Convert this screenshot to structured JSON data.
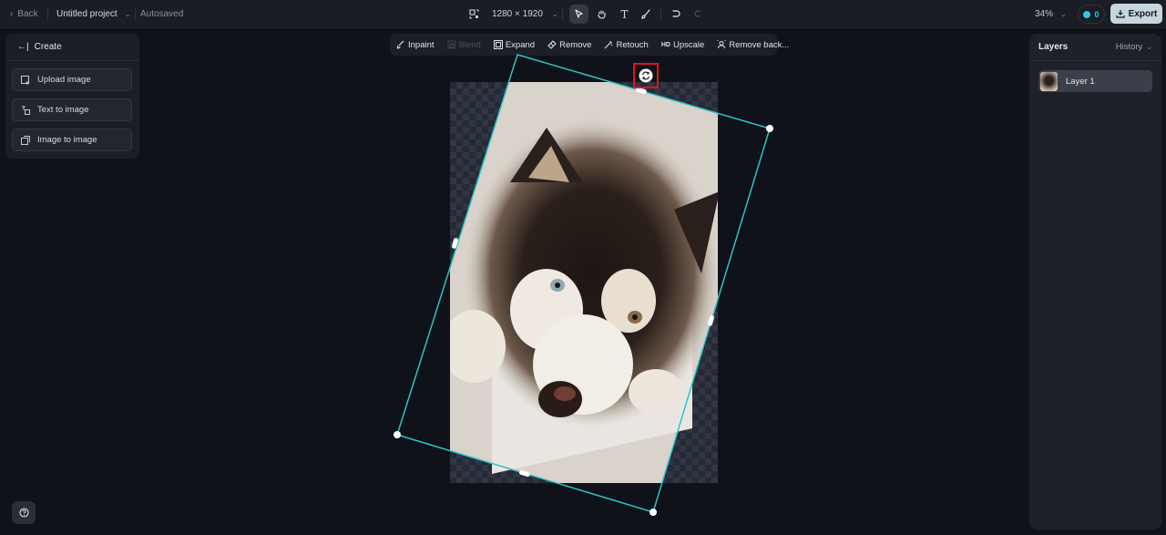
{
  "topbar": {
    "back_label": "Back",
    "project_title": "Untitled project",
    "autosave_status": "Autosaved",
    "canvas_size": "1280 × 1920",
    "zoom_level": "34%",
    "credits": "0",
    "export_label": "Export",
    "tools": [
      {
        "name": "select",
        "icon": "cursor-icon",
        "active": true
      },
      {
        "name": "hand",
        "icon": "hand-icon",
        "active": false
      },
      {
        "name": "text",
        "icon": "text-icon",
        "active": false
      },
      {
        "name": "brush",
        "icon": "brush-icon",
        "active": false
      }
    ]
  },
  "create_panel": {
    "title": "Create",
    "items": [
      {
        "label": "Upload image",
        "icon": "upload-image-icon"
      },
      {
        "label": "Text to image",
        "icon": "text-to-image-icon"
      },
      {
        "label": "Image to image",
        "icon": "image-to-image-icon"
      }
    ]
  },
  "ai_toolbar": {
    "items": [
      {
        "label": "Inpaint",
        "icon": "inpaint-icon",
        "enabled": true
      },
      {
        "label": "Blend",
        "icon": "blend-icon",
        "enabled": false
      },
      {
        "label": "Expand",
        "icon": "expand-icon",
        "enabled": true
      },
      {
        "label": "Remove",
        "icon": "eraser-icon",
        "enabled": true
      },
      {
        "label": "Retouch",
        "icon": "magic-wand-icon",
        "enabled": true
      },
      {
        "label": "Upscale",
        "icon": "hd-icon",
        "badge": "HD",
        "enabled": true
      },
      {
        "label": "Remove back...",
        "icon": "remove-background-icon",
        "enabled": true
      }
    ]
  },
  "layers_panel": {
    "title": "Layers",
    "history_label": "History",
    "layers": [
      {
        "name": "Layer 1",
        "selected": true
      }
    ]
  },
  "colors": {
    "selection": "#2ec4c9",
    "highlight_box": "#e0141e",
    "export_bg": "#c7d5de",
    "credit_accent": "#33c5e6"
  }
}
